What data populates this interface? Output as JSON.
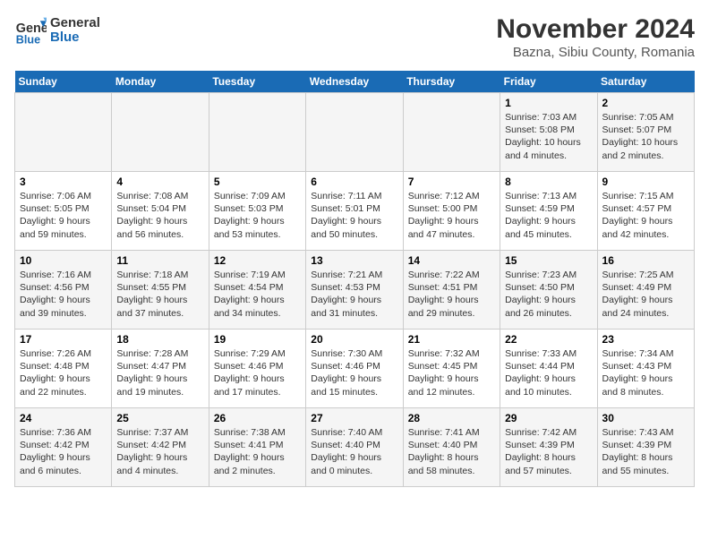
{
  "header": {
    "logo_line1": "General",
    "logo_line2": "Blue",
    "title": "November 2024",
    "subtitle": "Bazna, Sibiu County, Romania"
  },
  "days_of_week": [
    "Sunday",
    "Monday",
    "Tuesday",
    "Wednesday",
    "Thursday",
    "Friday",
    "Saturday"
  ],
  "weeks": [
    [
      {
        "day": "",
        "info": ""
      },
      {
        "day": "",
        "info": ""
      },
      {
        "day": "",
        "info": ""
      },
      {
        "day": "",
        "info": ""
      },
      {
        "day": "",
        "info": ""
      },
      {
        "day": "1",
        "info": "Sunrise: 7:03 AM\nSunset: 5:08 PM\nDaylight: 10 hours and 4 minutes."
      },
      {
        "day": "2",
        "info": "Sunrise: 7:05 AM\nSunset: 5:07 PM\nDaylight: 10 hours and 2 minutes."
      }
    ],
    [
      {
        "day": "3",
        "info": "Sunrise: 7:06 AM\nSunset: 5:05 PM\nDaylight: 9 hours and 59 minutes."
      },
      {
        "day": "4",
        "info": "Sunrise: 7:08 AM\nSunset: 5:04 PM\nDaylight: 9 hours and 56 minutes."
      },
      {
        "day": "5",
        "info": "Sunrise: 7:09 AM\nSunset: 5:03 PM\nDaylight: 9 hours and 53 minutes."
      },
      {
        "day": "6",
        "info": "Sunrise: 7:11 AM\nSunset: 5:01 PM\nDaylight: 9 hours and 50 minutes."
      },
      {
        "day": "7",
        "info": "Sunrise: 7:12 AM\nSunset: 5:00 PM\nDaylight: 9 hours and 47 minutes."
      },
      {
        "day": "8",
        "info": "Sunrise: 7:13 AM\nSunset: 4:59 PM\nDaylight: 9 hours and 45 minutes."
      },
      {
        "day": "9",
        "info": "Sunrise: 7:15 AM\nSunset: 4:57 PM\nDaylight: 9 hours and 42 minutes."
      }
    ],
    [
      {
        "day": "10",
        "info": "Sunrise: 7:16 AM\nSunset: 4:56 PM\nDaylight: 9 hours and 39 minutes."
      },
      {
        "day": "11",
        "info": "Sunrise: 7:18 AM\nSunset: 4:55 PM\nDaylight: 9 hours and 37 minutes."
      },
      {
        "day": "12",
        "info": "Sunrise: 7:19 AM\nSunset: 4:54 PM\nDaylight: 9 hours and 34 minutes."
      },
      {
        "day": "13",
        "info": "Sunrise: 7:21 AM\nSunset: 4:53 PM\nDaylight: 9 hours and 31 minutes."
      },
      {
        "day": "14",
        "info": "Sunrise: 7:22 AM\nSunset: 4:51 PM\nDaylight: 9 hours and 29 minutes."
      },
      {
        "day": "15",
        "info": "Sunrise: 7:23 AM\nSunset: 4:50 PM\nDaylight: 9 hours and 26 minutes."
      },
      {
        "day": "16",
        "info": "Sunrise: 7:25 AM\nSunset: 4:49 PM\nDaylight: 9 hours and 24 minutes."
      }
    ],
    [
      {
        "day": "17",
        "info": "Sunrise: 7:26 AM\nSunset: 4:48 PM\nDaylight: 9 hours and 22 minutes."
      },
      {
        "day": "18",
        "info": "Sunrise: 7:28 AM\nSunset: 4:47 PM\nDaylight: 9 hours and 19 minutes."
      },
      {
        "day": "19",
        "info": "Sunrise: 7:29 AM\nSunset: 4:46 PM\nDaylight: 9 hours and 17 minutes."
      },
      {
        "day": "20",
        "info": "Sunrise: 7:30 AM\nSunset: 4:46 PM\nDaylight: 9 hours and 15 minutes."
      },
      {
        "day": "21",
        "info": "Sunrise: 7:32 AM\nSunset: 4:45 PM\nDaylight: 9 hours and 12 minutes."
      },
      {
        "day": "22",
        "info": "Sunrise: 7:33 AM\nSunset: 4:44 PM\nDaylight: 9 hours and 10 minutes."
      },
      {
        "day": "23",
        "info": "Sunrise: 7:34 AM\nSunset: 4:43 PM\nDaylight: 9 hours and 8 minutes."
      }
    ],
    [
      {
        "day": "24",
        "info": "Sunrise: 7:36 AM\nSunset: 4:42 PM\nDaylight: 9 hours and 6 minutes."
      },
      {
        "day": "25",
        "info": "Sunrise: 7:37 AM\nSunset: 4:42 PM\nDaylight: 9 hours and 4 minutes."
      },
      {
        "day": "26",
        "info": "Sunrise: 7:38 AM\nSunset: 4:41 PM\nDaylight: 9 hours and 2 minutes."
      },
      {
        "day": "27",
        "info": "Sunrise: 7:40 AM\nSunset: 4:40 PM\nDaylight: 9 hours and 0 minutes."
      },
      {
        "day": "28",
        "info": "Sunrise: 7:41 AM\nSunset: 4:40 PM\nDaylight: 8 hours and 58 minutes."
      },
      {
        "day": "29",
        "info": "Sunrise: 7:42 AM\nSunset: 4:39 PM\nDaylight: 8 hours and 57 minutes."
      },
      {
        "day": "30",
        "info": "Sunrise: 7:43 AM\nSunset: 4:39 PM\nDaylight: 8 hours and 55 minutes."
      }
    ]
  ]
}
